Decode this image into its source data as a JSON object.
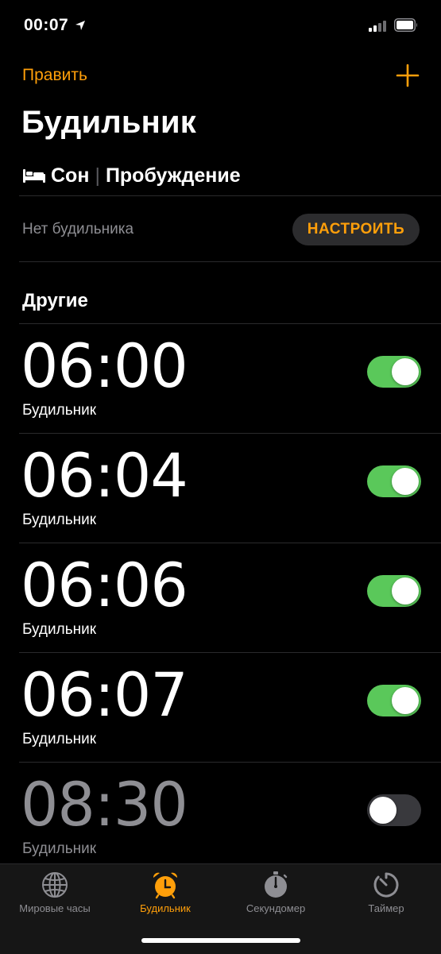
{
  "status_bar": {
    "time": "00:07"
  },
  "nav": {
    "edit_label": "Править"
  },
  "title": "Будильник",
  "sleep": {
    "sleep_label": "Сон",
    "separator": "|",
    "wake_label": "Пробуждение",
    "no_alarm": "Нет будильника",
    "setup_label": "НАСТРОИТЬ"
  },
  "section": {
    "title": "Другие"
  },
  "alarms": [
    {
      "time": "06:00",
      "label": "Будильник",
      "enabled": true
    },
    {
      "time": "06:04",
      "label": "Будильник",
      "enabled": true
    },
    {
      "time": "06:06",
      "label": "Будильник",
      "enabled": true
    },
    {
      "time": "06:07",
      "label": "Будильник",
      "enabled": true
    },
    {
      "time": "08:30",
      "label": "Будильник",
      "enabled": false
    }
  ],
  "tabs": [
    {
      "label": "Мировые часы",
      "icon": "globe-icon",
      "active": false
    },
    {
      "label": "Будильник",
      "icon": "alarm-clock-icon",
      "active": true
    },
    {
      "label": "Секундомер",
      "icon": "stopwatch-icon",
      "active": false
    },
    {
      "label": "Таймер",
      "icon": "timer-icon",
      "active": false
    }
  ],
  "colors": {
    "accent": "#ff9f0a",
    "toggle_on": "#5ac85a",
    "toggle_off": "#39393d",
    "secondary_text": "#8e8e93"
  }
}
